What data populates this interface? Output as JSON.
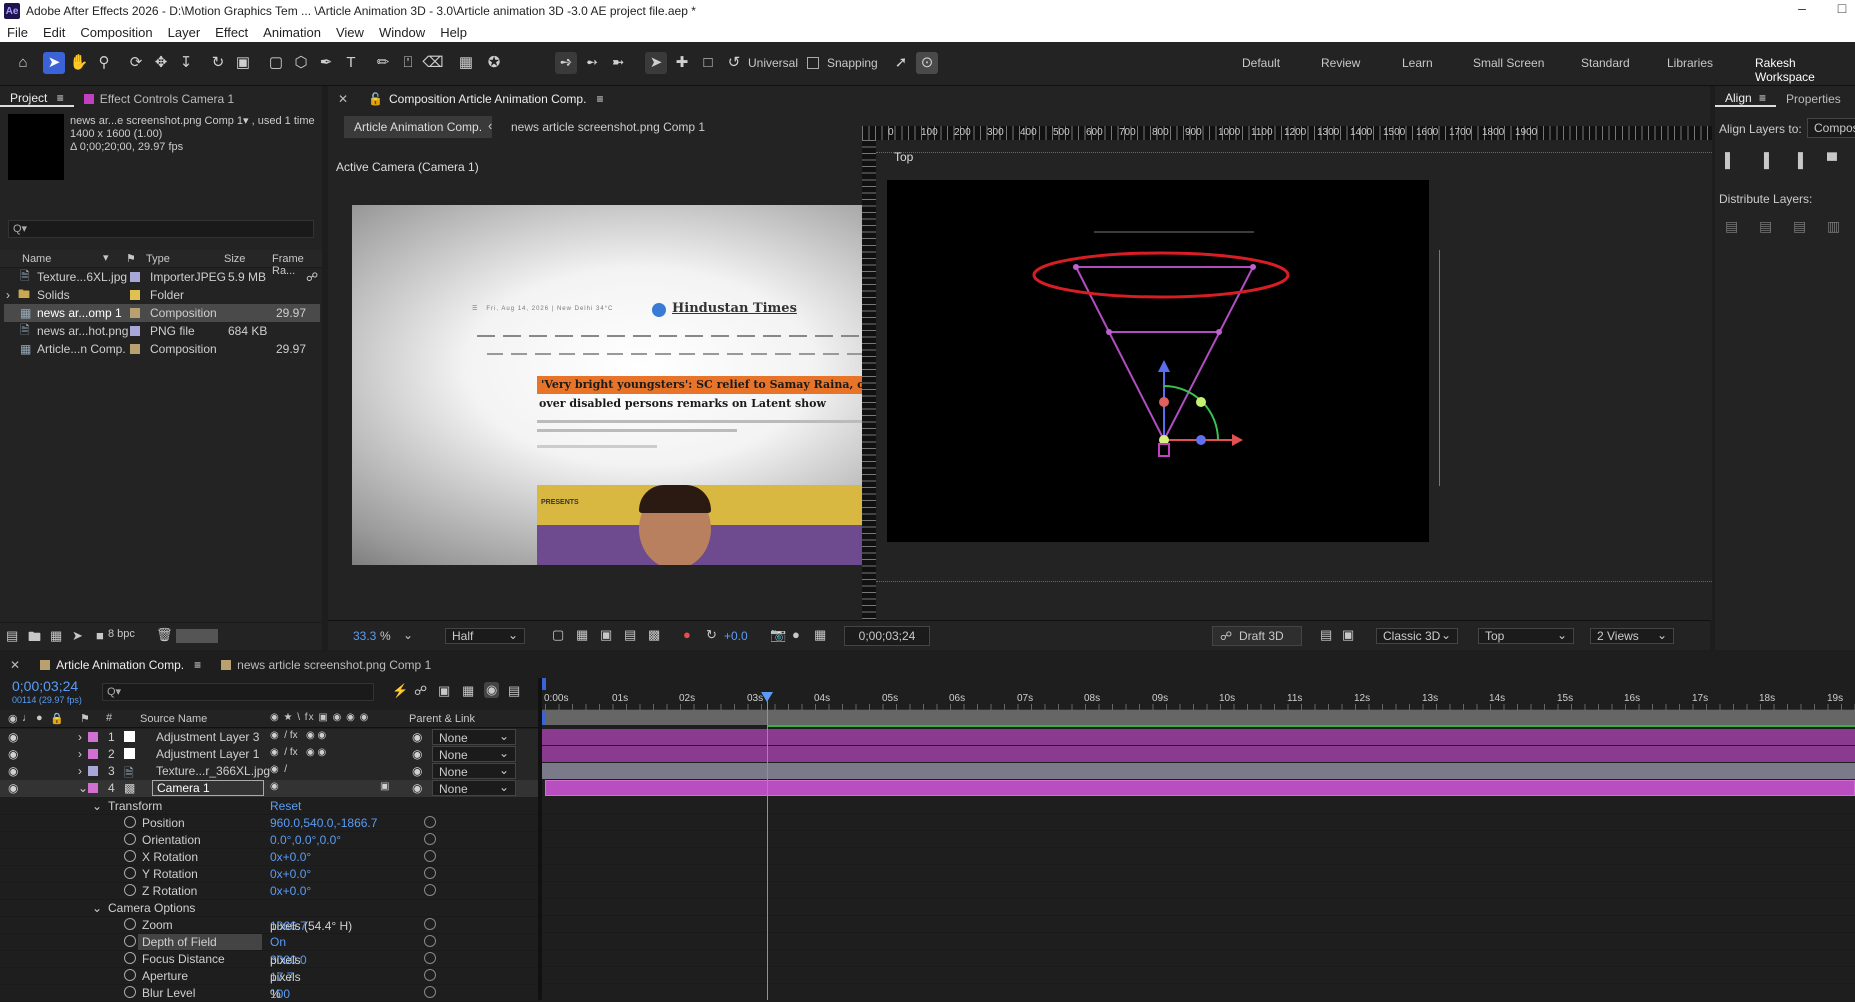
{
  "window": {
    "title": "Adobe After Effects 2026 - D:\\Motion Graphics Tem ... \\Article Animation 3D - 3.0\\Article animation 3D -3.0 AE project file.aep *",
    "logo": "Ae"
  },
  "menu": [
    "File",
    "Edit",
    "Composition",
    "Layer",
    "Effect",
    "Animation",
    "View",
    "Window",
    "Help"
  ],
  "toolbar": {
    "axis_mode": "Universal",
    "snapping": "Snapping",
    "workspaces": [
      "Default",
      "Review",
      "Learn",
      "Small Screen",
      "Standard",
      "Libraries",
      "Rakesh Workspace"
    ],
    "active_workspace": "Rakesh Workspace"
  },
  "project": {
    "tab_project": "Project",
    "tab_effect_controls": "Effect Controls Camera 1",
    "selected_name": "news ar...e screenshot.png Comp 1▾ , used 1 time",
    "selected_dims": "1400 x 1600 (1.00)",
    "selected_duration": "Δ 0;00;20;00, 29.97 fps",
    "search_placeholder": "Q▾",
    "columns": [
      "Name",
      "Type",
      "Size",
      "Frame Ra..."
    ],
    "items": [
      {
        "name": "Texture...6XL.jpg",
        "type": "ImporterJPEG",
        "size": "5.9 MB",
        "fps": "",
        "color": "#a8a8d8"
      },
      {
        "name": "Solids",
        "type": "Folder",
        "size": "",
        "fps": "",
        "color": "#e0c050"
      },
      {
        "name": "news ar...omp 1",
        "type": "Composition",
        "size": "",
        "fps": "29.97",
        "color": "#b8a070"
      },
      {
        "name": "news ar...hot.png",
        "type": "PNG file",
        "size": "684 KB",
        "fps": "",
        "color": "#a8a8d8"
      },
      {
        "name": "Article...n Comp.",
        "type": "Composition",
        "size": "",
        "fps": "29.97",
        "color": "#b8a070"
      }
    ],
    "bpc": "8 bpc"
  },
  "composition": {
    "tab_title": "Composition Article Animation Comp.",
    "breadcrumb": [
      "Article Animation Comp.",
      "news article screenshot.png Comp 1"
    ],
    "left_view_label": "Active Camera (Camera 1)",
    "right_view_label": "Top",
    "article": {
      "brand": "Hindustan Times",
      "headline_1": "'Very bright youngsters': SC relief to Samay Raina, others",
      "headline_2": "over disabled persons remarks on Latent show",
      "presents": "PRESENTS"
    },
    "ruler_ticks": [
      "0",
      "100",
      "200",
      "300",
      "400",
      "500",
      "600",
      "700",
      "800",
      "900",
      "1000",
      "1100",
      "1200",
      "1300",
      "1400",
      "1500",
      "1600",
      "1700",
      "1800",
      "1900"
    ],
    "zoom": "33.3",
    "zoom_unit": "%",
    "resolution": "Half",
    "exposure": "+0.0",
    "timecode": "0;00;03;24",
    "renderer_mode": "Draft 3D",
    "renderer": "Classic 3D",
    "view": "Top",
    "views_layout": "2 Views"
  },
  "align": {
    "tab_align": "Align",
    "tab_properties": "Properties",
    "align_to_label": "Align Layers to:",
    "align_to_value": "Composition",
    "distribute_label": "Distribute Layers:"
  },
  "timeline": {
    "tab_active": "Article Animation Comp.",
    "tab_other": "news article screenshot.png Comp 1",
    "timecode": "0;00;03;24",
    "frame_info": "00114 (29.97 fps)",
    "col_source": "Source Name",
    "col_parent": "Parent & Link",
    "ruler": [
      "0:00s",
      "01s",
      "02s",
      "03s",
      "04s",
      "05s",
      "06s",
      "07s",
      "08s",
      "09s",
      "10s",
      "11s",
      "12s",
      "13s",
      "14s",
      "15s",
      "16s",
      "17s",
      "18s",
      "19s"
    ],
    "layers": [
      {
        "num": "1",
        "name": "Adjustment Layer 3",
        "parent": "None",
        "label_color": "#d070d0"
      },
      {
        "num": "2",
        "name": "Adjustment Layer 1",
        "parent": "None",
        "label_color": "#d070d0"
      },
      {
        "num": "3",
        "name": "Texture...r_366XL.jpg",
        "parent": "None",
        "label_color": "#a8a8d8"
      },
      {
        "num": "4",
        "name": "Camera 1",
        "parent": "None",
        "label_color": "#d070d0"
      }
    ],
    "transform": {
      "group": "Transform",
      "reset": "Reset",
      "props": [
        {
          "name": "Position",
          "value": "960.0,540.0,-1866.7"
        },
        {
          "name": "Orientation",
          "value": "0.0°,0.0°,0.0°"
        },
        {
          "name": "X Rotation",
          "value": "0x+0.0°"
        },
        {
          "name": "Y Rotation",
          "value": "0x+0.0°"
        },
        {
          "name": "Z Rotation",
          "value": "0x+0.0°"
        }
      ]
    },
    "camera_options": {
      "group": "Camera Options",
      "props": [
        {
          "name": "Zoom",
          "value": "1866.7",
          "unit": " pixels (54.4° H)"
        },
        {
          "name": "Depth of Field",
          "value": "On",
          "unit": ""
        },
        {
          "name": "Focus Distance",
          "value": "3000.0",
          "unit": " pixels"
        },
        {
          "name": "Aperture",
          "value": "17.7",
          "unit": " pixels"
        },
        {
          "name": "Blur Level",
          "value": "100",
          "unit": "%"
        }
      ]
    }
  }
}
